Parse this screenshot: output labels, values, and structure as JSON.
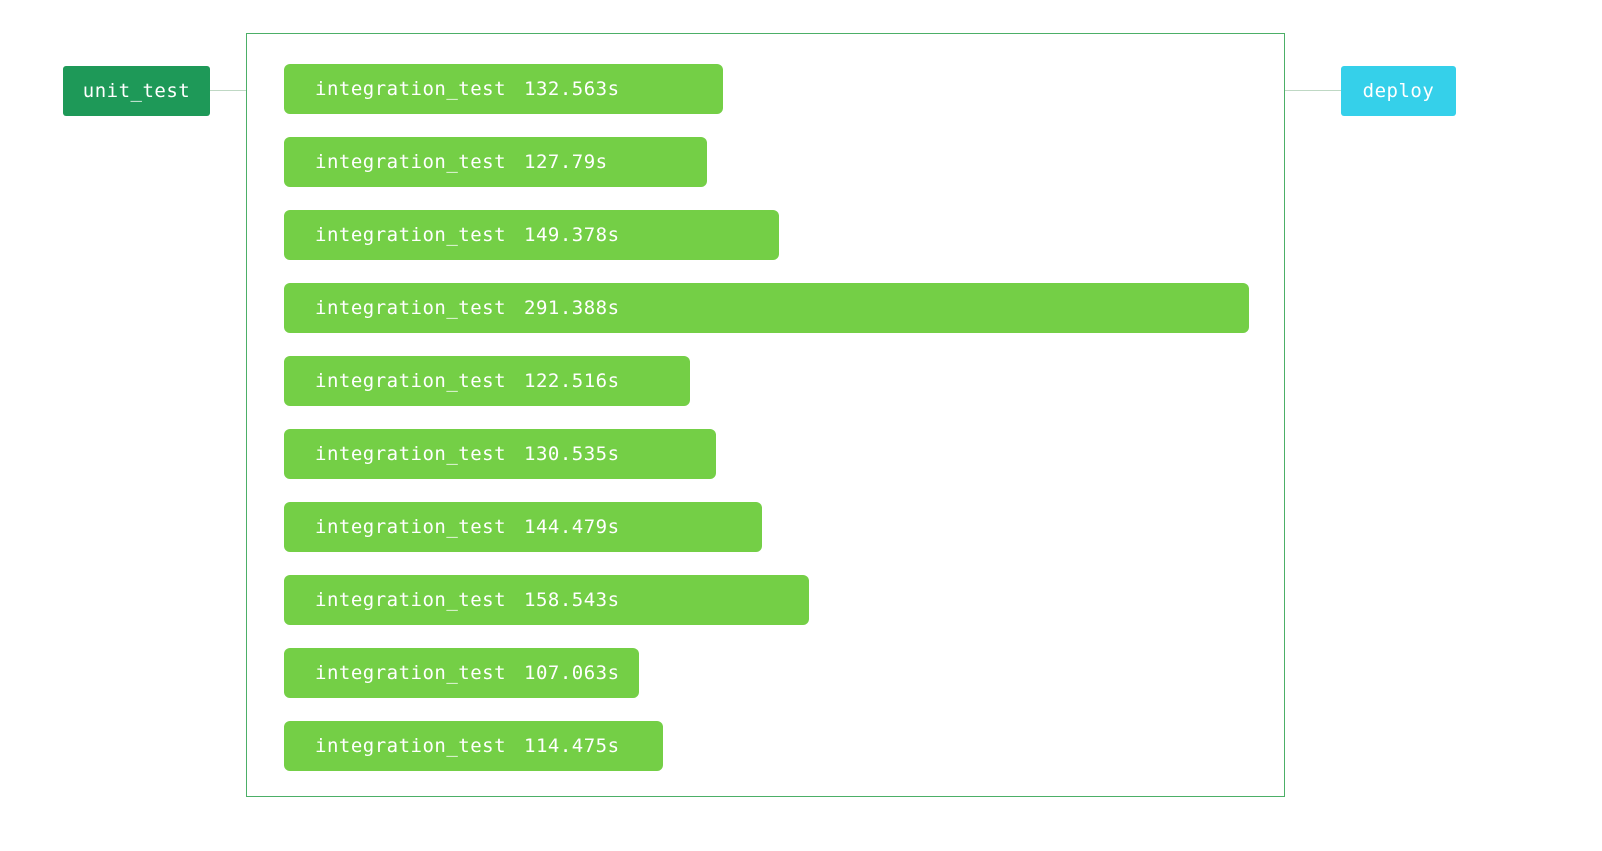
{
  "colors": {
    "unit_test_node": "#1e9958",
    "deploy_node": "#35d0ea",
    "job_bar": "#74cf46",
    "group_border": "#4caf67",
    "connector": "#bfd8c4"
  },
  "pipeline": {
    "upstream": {
      "label": "unit_test"
    },
    "downstream": {
      "label": "deploy"
    },
    "jobs": [
      {
        "name": "integration_test",
        "duration_label": "132.563s",
        "duration_s": 132.563
      },
      {
        "name": "integration_test",
        "duration_label": "127.79s",
        "duration_s": 127.79
      },
      {
        "name": "integration_test",
        "duration_label": "149.378s",
        "duration_s": 149.378
      },
      {
        "name": "integration_test",
        "duration_label": "291.388s",
        "duration_s": 291.388
      },
      {
        "name": "integration_test",
        "duration_label": "122.516s",
        "duration_s": 122.516
      },
      {
        "name": "integration_test",
        "duration_label": "130.535s",
        "duration_s": 130.535
      },
      {
        "name": "integration_test",
        "duration_label": "144.479s",
        "duration_s": 144.479
      },
      {
        "name": "integration_test",
        "duration_label": "158.543s",
        "duration_s": 158.543
      },
      {
        "name": "integration_test",
        "duration_label": "107.063s",
        "duration_s": 107.063
      },
      {
        "name": "integration_test",
        "duration_label": "114.475s",
        "duration_s": 114.475
      }
    ]
  }
}
